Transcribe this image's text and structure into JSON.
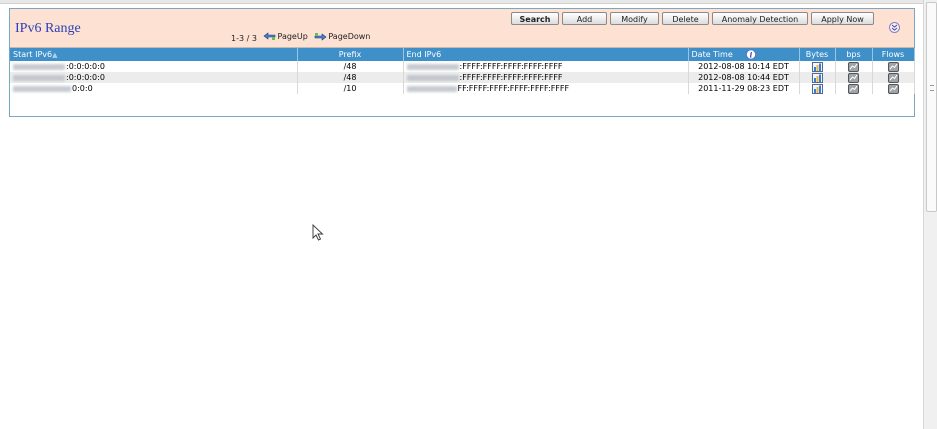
{
  "header": {
    "title": "IPv6 Range",
    "pager": {
      "count": "1-3 / 3",
      "page_up": "PageUp",
      "page_down": "PageDown"
    },
    "buttons": {
      "search": "Search",
      "add": "Add",
      "modify": "Modify",
      "delete": "Delete",
      "anomaly": "Anomaly Detection",
      "apply": "Apply Now"
    }
  },
  "table": {
    "columns": {
      "start": "Start IPv6",
      "prefix": "Prefix",
      "end": "End IPv6",
      "datetime": "Date Time",
      "bytes": "Bytes",
      "bps": "bps",
      "flows": "Flows"
    },
    "rows": [
      {
        "start_suffix": ":0:0:0:0:0",
        "prefix": "/48",
        "end_suffix": ":FFFF:FFFF:FFFF:FFFF:FFFF",
        "datetime": "2012-08-08 10:14 EDT"
      },
      {
        "start_suffix": ":0:0:0:0:0",
        "prefix": "/48",
        "end_suffix": ":FFFF:FFFF:FFFF:FFFF:FFFF",
        "datetime": "2012-08-08 10:44 EDT"
      },
      {
        "start_suffix": "0:0:0",
        "prefix": "/10",
        "end_suffix": "FF:FFFF:FFFF:FFFF:FFFF:FFFF",
        "datetime": "2011-11-29 08:23 EDT"
      }
    ]
  },
  "colors": {
    "header_bg": "#fde2d3",
    "title": "#2b3fb8",
    "column_header": "#3f8fc9",
    "row_alt": "#ececec"
  }
}
